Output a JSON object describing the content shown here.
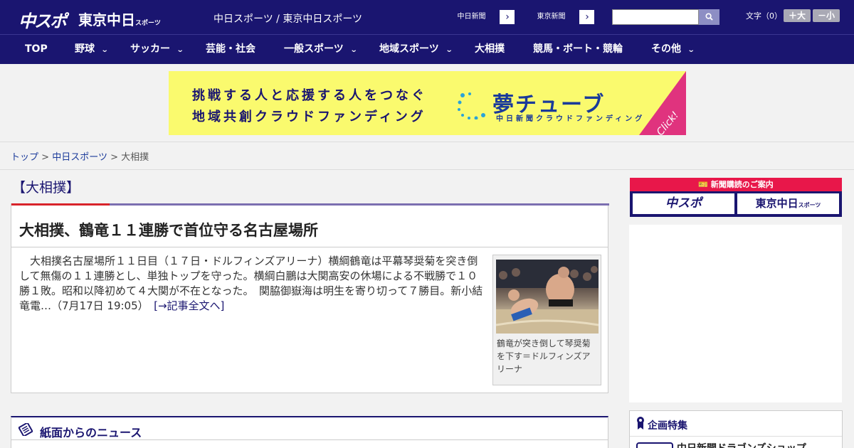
{
  "header": {
    "logo_chuspo": "中スポ",
    "logo_tokyo": "東京中日",
    "logo_tokyo_small": "スポーツ",
    "site_links": "中日スポーツ / 東京中日スポーツ",
    "paper_buttons": [
      {
        "label": "中日新聞",
        "arrow": "›"
      },
      {
        "label": "東京新聞",
        "arrow": "›"
      }
    ],
    "search": {
      "placeholder": "",
      "button_icon": "search-icon"
    },
    "text_size_label": "文字（0）",
    "text_size_plus": "＋大",
    "text_size_minus": "－小"
  },
  "nav": {
    "items": [
      {
        "label": "TOP",
        "has_menu": false
      },
      {
        "label": "野球",
        "has_menu": true
      },
      {
        "label": "サッカー",
        "has_menu": true
      },
      {
        "label": "芸能・社会",
        "has_menu": false
      },
      {
        "label": "一般スポーツ",
        "has_menu": true
      },
      {
        "label": "地域スポーツ",
        "has_menu": true
      },
      {
        "label": "大相撲",
        "has_menu": false
      },
      {
        "label": "競馬・ボート・競輪",
        "has_menu": false
      },
      {
        "label": "その他",
        "has_menu": true
      }
    ]
  },
  "banner": {
    "line1": "挑戦する人と応援する人をつなぐ",
    "line2": "地域共創クラウドファンディング",
    "logo": "夢チューブ",
    "sub": "中日新聞クラウドファンディング",
    "click": "Click!"
  },
  "breadcrumb": {
    "items": [
      "トップ",
      "中日スポーツ",
      "大相撲"
    ],
    "separator": ">"
  },
  "article": {
    "category": "【大相撲】",
    "headline": "大相撲、鶴竜１１連勝で首位守る名古屋場所",
    "body": "　大相撲名古屋場所１１日目（１７日・ドルフィンズアリーナ）横綱鶴竜は平幕琴奨菊を突き倒して無傷の１１連勝とし、単独トップを守った。横綱白鵬は大関高安の休場による不戦勝で１０勝１敗。昭和以降初めて４大関が不在となった。　関脇御嶽海は明生を寄り切って７勝目。新小結竜電…（7月17日 19:05）　",
    "more_link": "[→記事全文へ]",
    "photo_caption": "鶴竜が突き倒して琴奨菊を下す＝ドルフィンズアリーナ"
  },
  "paper_news": {
    "title": "紙面からのニュース"
  },
  "sidebar": {
    "subscribe_header": "新聞購読のご案内",
    "subscribe_buttons": [
      "中スポ",
      "東京中日"
    ],
    "subscribe_button2_small": "スポーツ",
    "feature_title": "企画特集",
    "feature_item": "中日新聞ドラゴンズショップ"
  },
  "colors": {
    "brand_navy": "#1a1570",
    "accent_red": "#d8232a",
    "subscribe_pink": "#e8174a",
    "banner_yellow": "#fafa6e"
  }
}
